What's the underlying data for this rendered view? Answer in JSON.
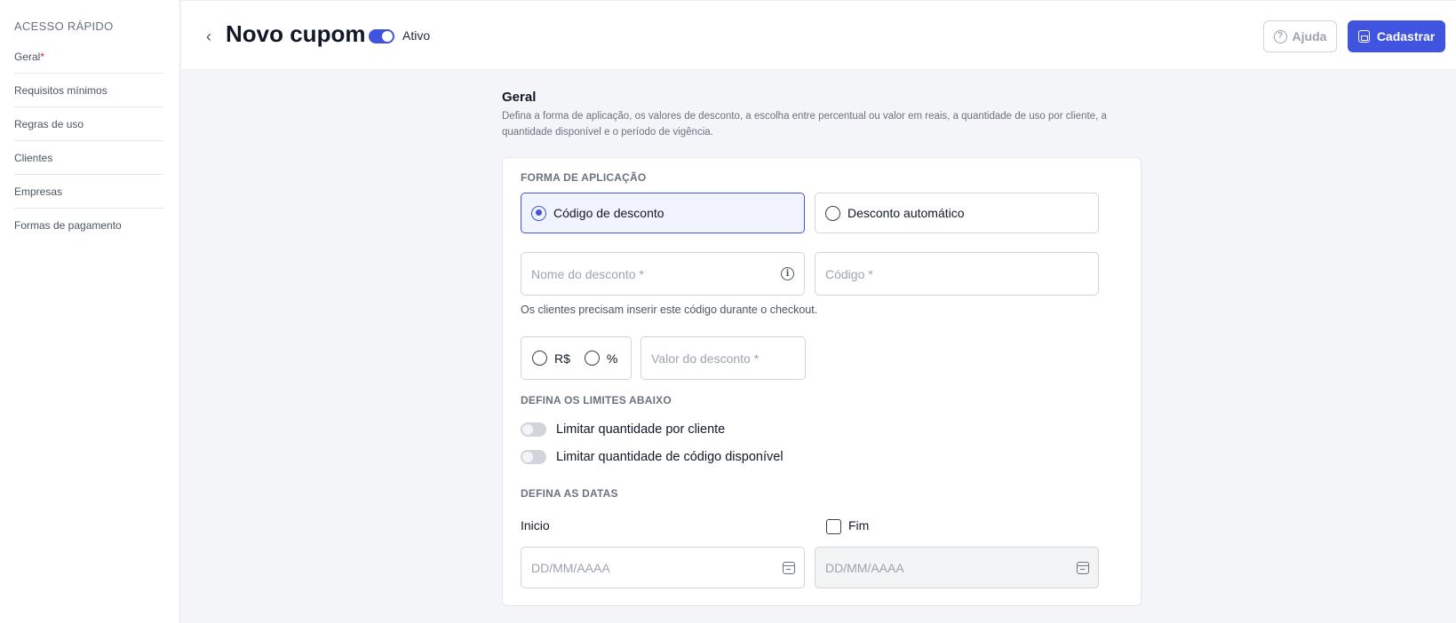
{
  "sidebar": {
    "title": "ACESSO RÁPIDO",
    "items": [
      {
        "label": "Geral",
        "required": "*"
      },
      {
        "label": "Requisitos mínimos"
      },
      {
        "label": "Regras de uso"
      },
      {
        "label": "Clientes"
      },
      {
        "label": "Empresas"
      },
      {
        "label": "Formas de pagamento"
      }
    ]
  },
  "header": {
    "title": "Novo cupom",
    "status_label": "Ativo",
    "status_on": true,
    "help_label": "Ajuda",
    "save_label": "Cadastrar",
    "accent": "#4154e0"
  },
  "section": {
    "title": "Geral",
    "description": "Defina a forma de aplicação, os valores de desconto, a escolha entre percentual ou valor em reais, a quantidade de uso por cliente, a quantidade disponível e o período de vigência."
  },
  "form": {
    "application_label": "FORMA DE APLICAÇÃO",
    "application_options": [
      {
        "label": "Código de desconto",
        "selected": true
      },
      {
        "label": "Desconto automático",
        "selected": false
      }
    ],
    "discount_name_placeholder": "Nome do desconto *",
    "code_placeholder": "Código *",
    "code_hint": "Os clientes precisam inserir este código durante o checkout.",
    "currency_options": [
      "R$",
      "%"
    ],
    "discount_value_placeholder": "Valor do desconto *",
    "limits_label": "DEFINA OS LIMITES ABAIXO",
    "limit_per_client": "Limitar quantidade por cliente",
    "limit_available": "Limitar quantidade de código disponível",
    "dates_label": "DEFINA AS DATAS",
    "start_label": "Inicio",
    "end_label": "Fim",
    "start_placeholder": "DD/MM/AAAA",
    "end_placeholder": "DD/MM/AAAA"
  }
}
